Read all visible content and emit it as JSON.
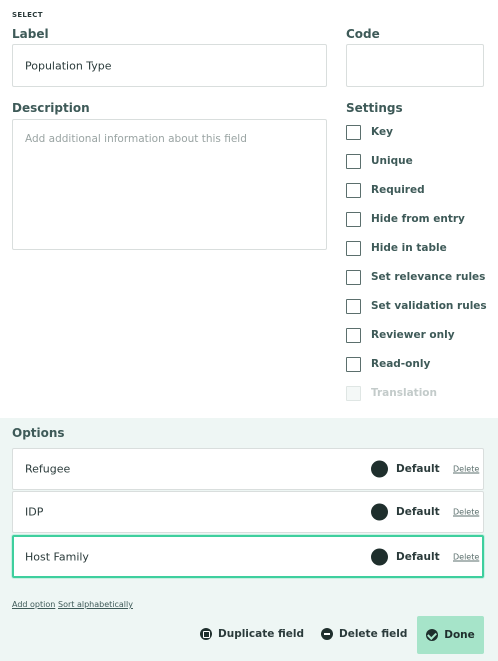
{
  "field_type": "SELECT",
  "label": {
    "title": "Label",
    "value": "Population Type"
  },
  "code": {
    "title": "Code",
    "value": ""
  },
  "description": {
    "title": "Description",
    "placeholder": "Add additional information about this field"
  },
  "settings": {
    "title": "Settings",
    "items": [
      {
        "label": "Key",
        "checked": false,
        "disabled": false
      },
      {
        "label": "Unique",
        "checked": false,
        "disabled": false
      },
      {
        "label": "Required",
        "checked": false,
        "disabled": false
      },
      {
        "label": "Hide from entry",
        "checked": false,
        "disabled": false
      },
      {
        "label": "Hide in table",
        "checked": false,
        "disabled": false
      },
      {
        "label": "Set relevance rules",
        "checked": false,
        "disabled": false
      },
      {
        "label": "Set validation rules",
        "checked": false,
        "disabled": false
      },
      {
        "label": "Reviewer only",
        "checked": false,
        "disabled": false
      },
      {
        "label": "Read-only",
        "checked": false,
        "disabled": false
      },
      {
        "label": "Translation",
        "checked": false,
        "disabled": true
      }
    ]
  },
  "options": {
    "title": "Options",
    "items": [
      {
        "name": "Refugee",
        "color_label": "Default",
        "delete_label": "Delete",
        "color": "#1f2f2d"
      },
      {
        "name": "IDP",
        "color_label": "Default",
        "delete_label": "Delete",
        "color": "#1f2f2d"
      },
      {
        "name": "Host Family",
        "color_label": "Default",
        "delete_label": "Delete",
        "color": "#1f2f2d",
        "focused": true
      }
    ],
    "add_option": "Add option",
    "sort": "Sort alphabetically"
  },
  "actions": {
    "duplicate": "Duplicate field",
    "delete": "Delete field",
    "done": "Done"
  },
  "colors": {
    "accent": "#3ecf9e",
    "done_bg": "#a6e4c9",
    "panel_bg": "#eef6f4"
  }
}
